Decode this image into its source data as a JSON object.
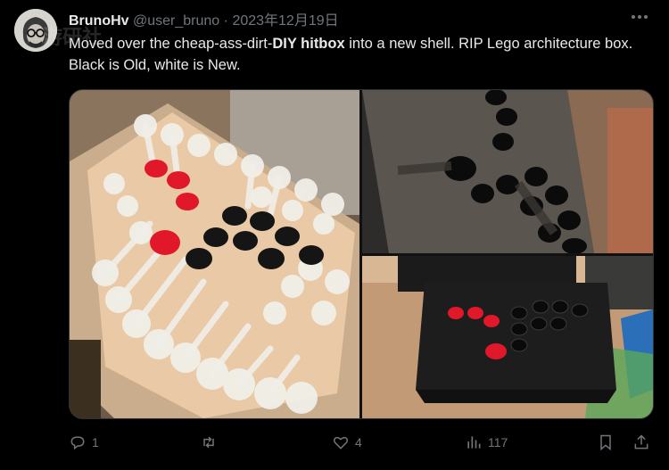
{
  "tweet": {
    "author_name": "BrunoHv",
    "handle": "@user_bruno",
    "separator": "·",
    "date": "2023年12月19日",
    "more_icon": "more-horizontal-icon",
    "text_before": "Moved over the cheap-ass-dirt-",
    "text_bold": "DIY hitbox",
    "text_after": " into a new shell. RIP Lego architecture box. Black is Old, white is New.",
    "watermark": "游研社"
  },
  "media": {
    "images": [
      "old-cardboard-hitbox-photo",
      "new-shell-interior-photo",
      "black-hitbox-on-desk-photo"
    ]
  },
  "actions": {
    "reply_count": "1",
    "retweet_count": "",
    "like_count": "4",
    "views_count": "117",
    "icons": [
      "reply-icon",
      "retweet-icon",
      "like-icon",
      "views-icon",
      "bookmark-icon",
      "share-icon"
    ]
  },
  "colors": {
    "background": "#000000",
    "text": "#e7e9ea",
    "muted": "#71767b",
    "button_red": "#e0182a",
    "button_black": "#111111"
  }
}
